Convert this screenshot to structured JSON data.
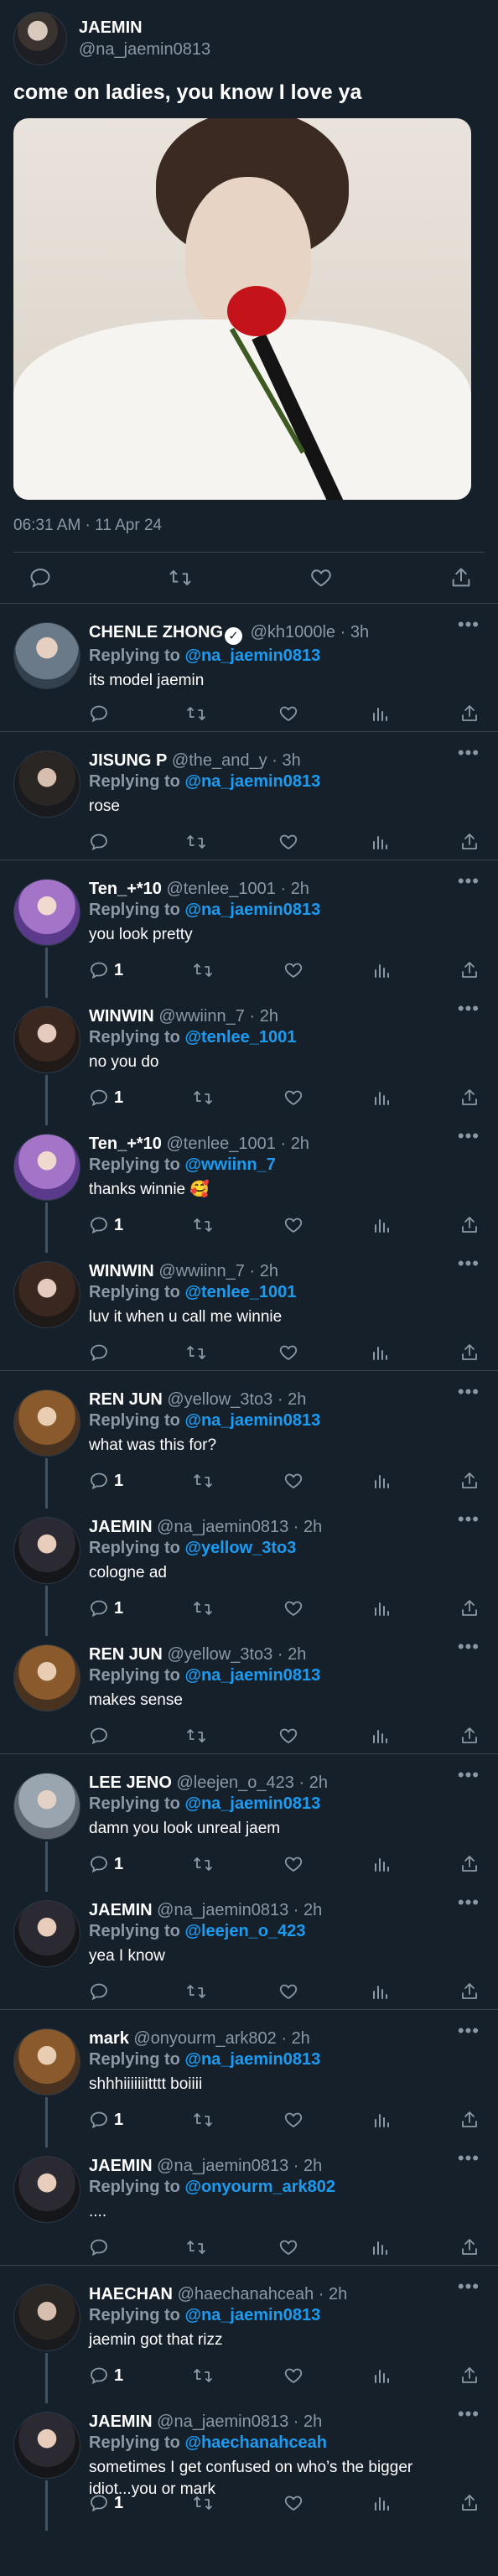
{
  "main_tweet": {
    "display_name": "JAEMIN",
    "handle": "@na_jaemin0813",
    "text": "come on ladies, you know I love ya",
    "timestamp": "06:31 AM · 11 Apr 24",
    "actions": [
      "reply-icon",
      "retweet-icon",
      "like-icon",
      "share-icon"
    ]
  },
  "replies": [
    {
      "name": "CHENLE ZHONG",
      "verified": true,
      "handle": "@kh1000le",
      "time": "3h",
      "replying_label": "Replying to",
      "replying_to": "@na_jaemin0813",
      "text": "its model jaemin",
      "reply_count": "",
      "separator_after": true
    },
    {
      "name": "JISUNG P",
      "verified": false,
      "handle": "@the_and_y",
      "time": "3h",
      "replying_label": "Replying to",
      "replying_to": "@na_jaemin0813",
      "text": "rose",
      "reply_count": "",
      "separator_after": true
    },
    {
      "name": "Ten_+*10",
      "verified": false,
      "handle": "@tenlee_1001",
      "time": "2h",
      "replying_label": "Replying to",
      "replying_to": "@na_jaemin0813",
      "text": "you look pretty",
      "reply_count": "1",
      "separator_after": false
    },
    {
      "name": "WINWIN",
      "verified": false,
      "handle": "@wwiinn_7",
      "time": "2h",
      "replying_label": "Replying to",
      "replying_to": "@tenlee_1001",
      "text": "no you do",
      "reply_count": "1",
      "separator_after": false
    },
    {
      "name": "Ten_+*10",
      "verified": false,
      "handle": "@tenlee_1001",
      "time": "2h",
      "replying_label": "Replying to",
      "replying_to": "@wwiinn_7",
      "text": "thanks winnie 🥰",
      "reply_count": "1",
      "separator_after": false
    },
    {
      "name": "WINWIN",
      "verified": false,
      "handle": "@wwiinn_7",
      "time": "2h",
      "replying_label": "Replying to",
      "replying_to": "@tenlee_1001",
      "text": "luv it when u call me winnie",
      "reply_count": "",
      "separator_after": true
    },
    {
      "name": "REN JUN",
      "verified": false,
      "handle": "@yellow_3to3",
      "time": "2h",
      "replying_label": "Replying to",
      "replying_to": "@na_jaemin0813",
      "text": "what was this for?",
      "reply_count": "1",
      "separator_after": false
    },
    {
      "name": "JAEMIN",
      "verified": false,
      "handle": "@na_jaemin0813",
      "time": "2h",
      "replying_label": "Replying to",
      "replying_to": "@yellow_3to3",
      "text": "cologne ad",
      "reply_count": "1",
      "separator_after": false
    },
    {
      "name": "REN JUN",
      "verified": false,
      "handle": "@yellow_3to3",
      "time": "2h",
      "replying_label": "Replying to",
      "replying_to": "@na_jaemin0813",
      "text": "makes sense",
      "reply_count": "",
      "separator_after": true
    },
    {
      "name": "LEE JENO",
      "verified": false,
      "handle": "@leejen_o_423",
      "time": "2h",
      "replying_label": "Replying to",
      "replying_to": "@na_jaemin0813",
      "text": "damn you look unreal jaem",
      "reply_count": "1",
      "separator_after": false
    },
    {
      "name": "JAEMIN",
      "verified": false,
      "handle": "@na_jaemin0813",
      "time": "2h",
      "replying_label": "Replying to",
      "replying_to": "@leejen_o_423",
      "text": "yea I know",
      "reply_count": "",
      "separator_after": true
    },
    {
      "name": "mark",
      "verified": false,
      "handle": "@onyourm_ark802",
      "time": "2h",
      "replying_label": "Replying to",
      "replying_to": "@na_jaemin0813",
      "text": "shhhiiiiiiitttt boiiii",
      "reply_count": "1",
      "separator_after": false
    },
    {
      "name": "JAEMIN",
      "verified": false,
      "handle": "@na_jaemin0813",
      "time": "2h",
      "replying_label": "Replying to",
      "replying_to": "@onyourm_ark802",
      "text": "....",
      "reply_count": "",
      "separator_after": true
    },
    {
      "name": "HAECHAN",
      "verified": false,
      "handle": "@haechanahceah",
      "time": "2h",
      "replying_label": "Replying to",
      "replying_to": "@na_jaemin0813",
      "text": "jaemin got that rizz",
      "reply_count": "1",
      "separator_after": false
    },
    {
      "name": "JAEMIN",
      "verified": false,
      "handle": "@na_jaemin0813",
      "time": "2h",
      "replying_label": "Replying to",
      "replying_to": "@haechanahceah",
      "text": "sometimes I get confused on who’s the bigger idiot...you or mark",
      "reply_count": "1",
      "separator_after": false
    }
  ],
  "ui": {
    "more_label": "•••",
    "verified_glyph": "✓",
    "dot": "·",
    "accent_color": "#1d9bf0",
    "background_color": "#15202b",
    "muted_color": "#8b98a5"
  }
}
